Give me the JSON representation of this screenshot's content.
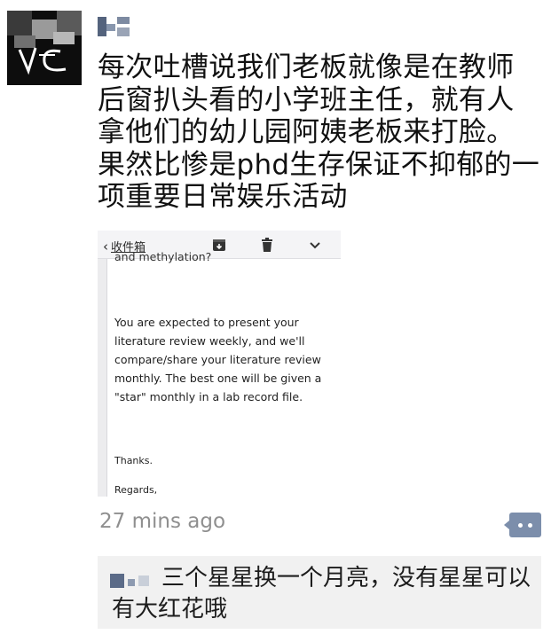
{
  "post": {
    "avatar_icon": "user-avatar-icon",
    "text": "每次吐槽说我们老板就像是在教师后窗扒头看的小学班主任，就有人拿他们的幼儿园阿姨老板来打脸。果然比惨是phd生存保证不抑郁的一项重要日常娱乐活动",
    "timestamp": "27 mins ago",
    "comment_icon": "comment-icon"
  },
  "email_screenshot": {
    "back_label": "收件箱",
    "icons": [
      "archive-icon",
      "trash-icon",
      "chevron-down-icon"
    ],
    "clipped_top_line": "and methylation?",
    "body": "You are expected to present your literature review weekly, and we'll compare/share your literature review monthly. The best one will be given a \"star\" monthly in a lab record file.",
    "thanks": "Thanks.",
    "regards": "Regards,"
  },
  "comment": {
    "text": "三个星星换一个月亮，没有星星可以有大红花哦"
  },
  "colors": {
    "accent": "#7c8eab",
    "timestamp": "#8f8f8f",
    "comment_bg": "#f1f1f1"
  }
}
